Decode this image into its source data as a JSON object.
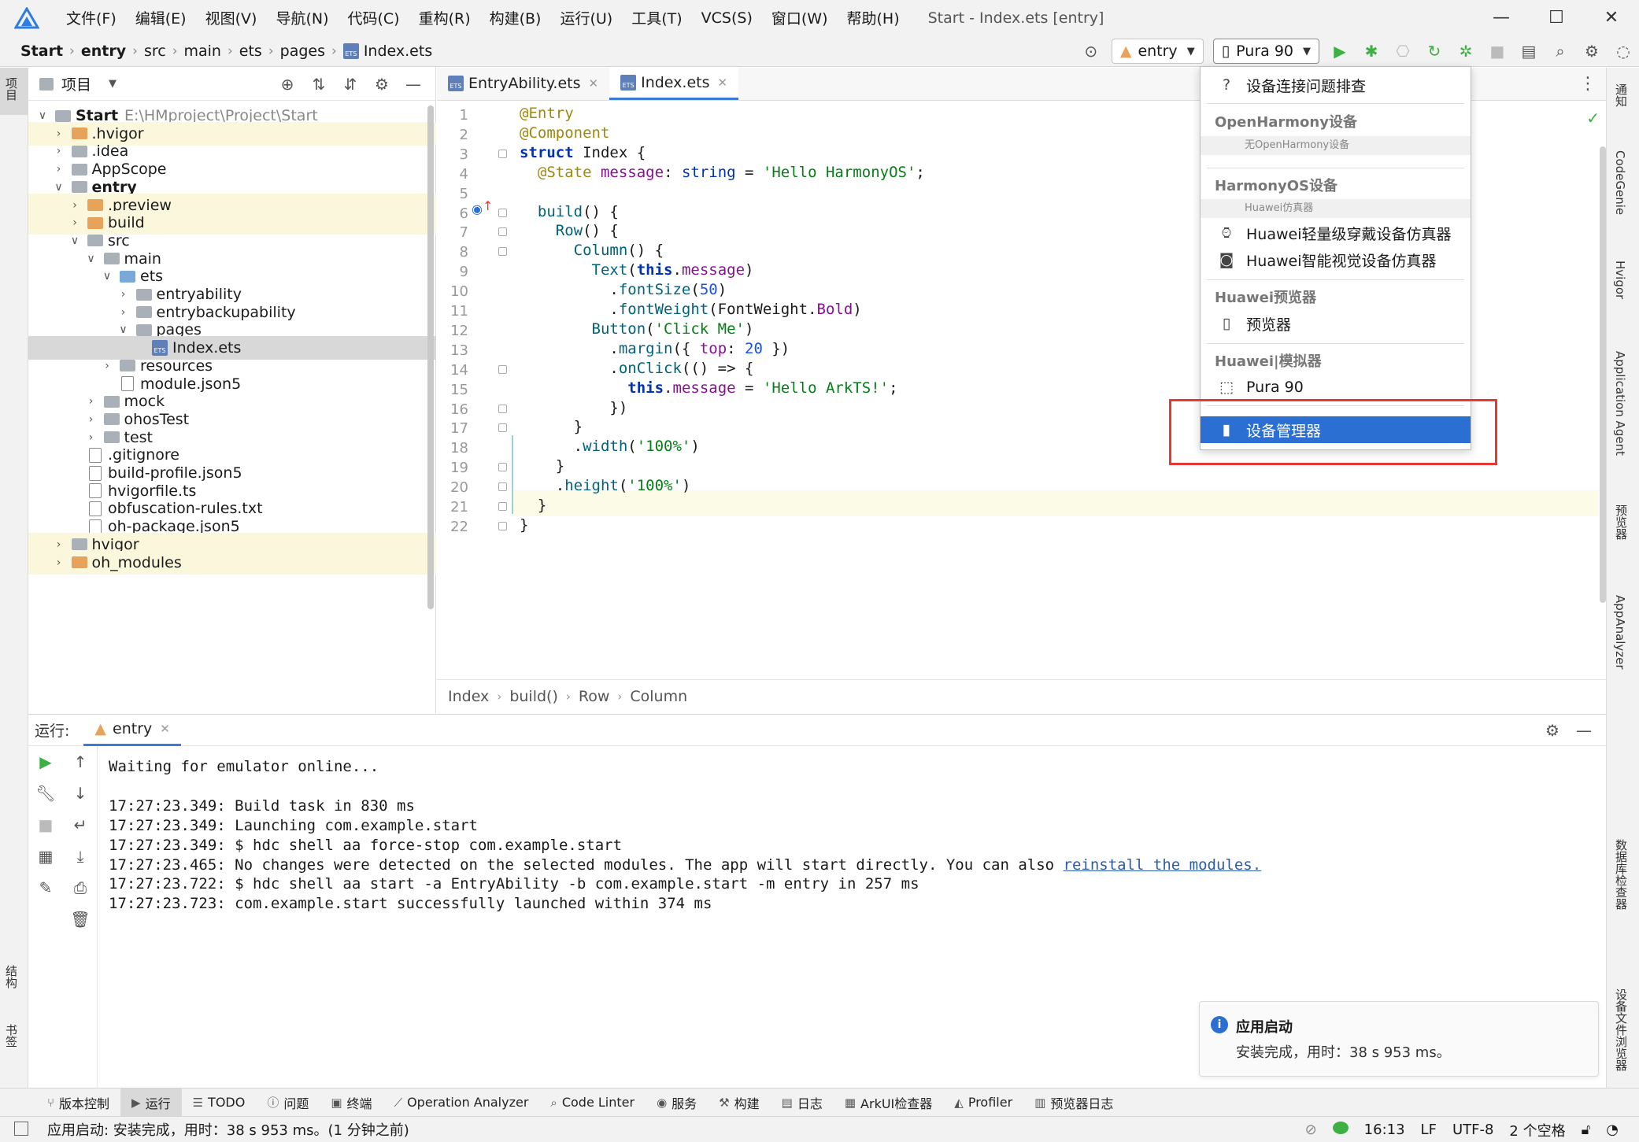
{
  "window": {
    "title": "Start - Index.ets [entry]",
    "menu": [
      "文件(F)",
      "编辑(E)",
      "视图(V)",
      "导航(N)",
      "代码(C)",
      "重构(R)",
      "构建(B)",
      "运行(U)",
      "工具(T)",
      "VCS(S)",
      "窗口(W)",
      "帮助(H)"
    ]
  },
  "breadcrumb": {
    "project": "Start",
    "module": "entry",
    "p1": "src",
    "p2": "main",
    "p3": "ets",
    "p4": "pages",
    "file": "Index.ets",
    "ets_badge": "ETS"
  },
  "toolbar": {
    "module_combo": "entry",
    "device_combo": "Pura 90"
  },
  "left_strip": {
    "project": "项目",
    "structure": "结构",
    "bookmarks": "书签"
  },
  "project_panel": {
    "title": "项目",
    "tree": [
      {
        "label": "Start",
        "path": "E:\\HMproject\\Project\\Start",
        "depth": 0,
        "expanded": true,
        "kind": "root"
      },
      {
        "label": ".hvigor",
        "depth": 1,
        "kind": "folder-orange"
      },
      {
        "label": ".idea",
        "depth": 1,
        "kind": "folder"
      },
      {
        "label": "AppScope",
        "depth": 1,
        "kind": "folder"
      },
      {
        "label": "entry",
        "depth": 1,
        "expanded": true,
        "kind": "folder-bold"
      },
      {
        "label": ".preview",
        "depth": 2,
        "kind": "folder-orange"
      },
      {
        "label": "build",
        "depth": 2,
        "kind": "folder-orange"
      },
      {
        "label": "src",
        "depth": 2,
        "expanded": true,
        "kind": "folder"
      },
      {
        "label": "main",
        "depth": 3,
        "expanded": true,
        "kind": "folder"
      },
      {
        "label": "ets",
        "depth": 4,
        "expanded": true,
        "kind": "folder-blue"
      },
      {
        "label": "entryability",
        "depth": 5,
        "kind": "folder"
      },
      {
        "label": "entrybackupability",
        "depth": 5,
        "kind": "folder"
      },
      {
        "label": "pages",
        "depth": 5,
        "expanded": true,
        "kind": "folder"
      },
      {
        "label": "Index.ets",
        "depth": 6,
        "kind": "ets"
      },
      {
        "label": "resources",
        "depth": 4,
        "kind": "folder"
      },
      {
        "label": "module.json5",
        "depth": 4,
        "kind": "file"
      },
      {
        "label": "mock",
        "depth": 3,
        "kind": "folder"
      },
      {
        "label": "ohosTest",
        "depth": 3,
        "kind": "folder"
      },
      {
        "label": "test",
        "depth": 3,
        "kind": "folder"
      },
      {
        "label": ".gitignore",
        "depth": 2,
        "kind": "file"
      },
      {
        "label": "build-profile.json5",
        "depth": 2,
        "kind": "file"
      },
      {
        "label": "hvigorfile.ts",
        "depth": 2,
        "kind": "file"
      },
      {
        "label": "obfuscation-rules.txt",
        "depth": 2,
        "kind": "file"
      },
      {
        "label": "oh-package.json5",
        "depth": 2,
        "kind": "file"
      },
      {
        "label": "hvigor",
        "depth": 1,
        "kind": "folder"
      },
      {
        "label": "oh_modules",
        "depth": 1,
        "kind": "folder-orange"
      }
    ]
  },
  "editor": {
    "tabs": [
      {
        "label": "EntryAbility.ets",
        "active": false
      },
      {
        "label": "Index.ets",
        "active": true
      }
    ],
    "line_numbers": [
      "1",
      "2",
      "3",
      "4",
      "5",
      "6",
      "7",
      "8",
      "9",
      "10",
      "11",
      "12",
      "13",
      "14",
      "15",
      "16",
      "17",
      "18",
      "19",
      "20",
      "21",
      "22"
    ],
    "code": [
      "@Entry",
      "@Component",
      "struct Index {",
      "  @State message: string = 'Hello HarmonyOS';",
      "",
      "  build() {",
      "    Row() {",
      "      Column() {",
      "        Text(this.message)",
      "          .fontSize(50)",
      "          .fontWeight(FontWeight.Bold)",
      "        Button('Click Me')",
      "          .margin({ top: 20 })",
      "          .onClick(() => {",
      "            this.message = 'Hello ArkTS!';",
      "          })",
      "      }",
      "      .width('100%')",
      "    }",
      "    .height('100%')",
      "  }",
      "}"
    ],
    "crumb": [
      "Index",
      "build()",
      "Row",
      "Column"
    ]
  },
  "run_panel": {
    "label": "运行:",
    "tab": "entry",
    "lines": [
      "Waiting for emulator online...",
      "",
      "17:27:23.349: Build task in 830 ms",
      "17:27:23.349: Launching com.example.start",
      "17:27:23.349: $ hdc shell aa force-stop com.example.start",
      "17:27:23.465: No changes were detected on the selected modules. The app will start directly. You can also ",
      "17:27:23.722: $ hdc shell aa start -a EntryAbility -b com.example.start -m entry in 257 ms",
      "17:27:23.723: com.example.start successfully launched within 374 ms"
    ],
    "link": "reinstall the modules."
  },
  "dropdown": {
    "troubleshoot": "设备连接问题排查",
    "openharmony_head": "OpenHarmony设备",
    "openharmony_empty": "无OpenHarmony设备",
    "harmonyos_head": "HarmonyOS设备",
    "huawei_sim_sub": "Huawei仿真器",
    "wearable_sim": "Huawei轻量级穿戴设备仿真器",
    "vision_sim": "Huawei智能视觉设备仿真器",
    "previewer_head": "Huawei预览器",
    "previewer": "预览器",
    "emulator_head": "Huawei|模拟器",
    "pura": "Pura 90",
    "device_manager": "设备管理器"
  },
  "right_strip": [
    "通知",
    "CodeGenie",
    "Hvigor",
    "Application Agent",
    "预览器",
    "AppAnalyzer",
    "数据库检查器",
    "设备文件浏览器"
  ],
  "bottom_tools": [
    {
      "label": "版本控制",
      "icon": "branch-icon"
    },
    {
      "label": "运行",
      "icon": "play-icon",
      "active": true
    },
    {
      "label": "TODO",
      "icon": "list-icon"
    },
    {
      "label": "问题",
      "icon": "info-icon"
    },
    {
      "label": "终端",
      "icon": "terminal-icon"
    },
    {
      "label": "Operation Analyzer",
      "icon": "chart-icon"
    },
    {
      "label": "Code Linter",
      "icon": "magnifier-icon"
    },
    {
      "label": "服务",
      "icon": "service-icon"
    },
    {
      "label": "构建",
      "icon": "hammer-icon"
    },
    {
      "label": "日志",
      "icon": "log-icon"
    },
    {
      "label": "ArkUI检查器",
      "icon": "inspector-icon"
    },
    {
      "label": "Profiler",
      "icon": "profiler-icon"
    },
    {
      "label": "预览器日志",
      "icon": "preview-log-icon"
    }
  ],
  "statusbar": {
    "message": "应用启动: 安装完成，用时：38 s 953 ms。(1 分钟之前)",
    "position": "16:13",
    "line_ending": "LF",
    "encoding": "UTF-8",
    "indent": "2 个空格"
  },
  "notification": {
    "title": "应用启动",
    "body": "安装完成，用时：38 s 953 ms。"
  },
  "colors": {
    "accent": "#2a6fd1",
    "highlight_red": "#e53935",
    "run_green": "#3cb043"
  }
}
